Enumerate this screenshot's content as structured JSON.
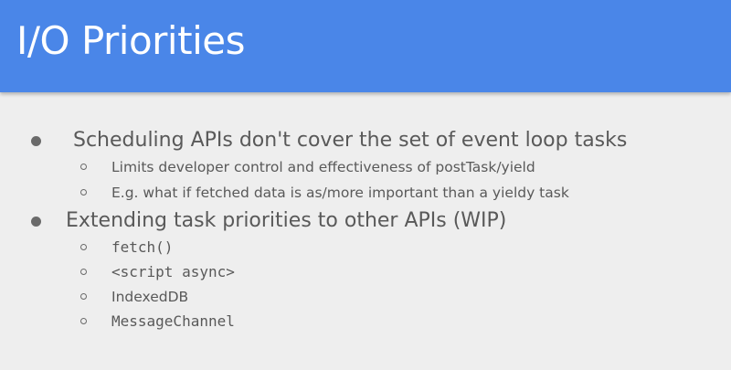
{
  "slide": {
    "title": "I/O Priorities",
    "colors": {
      "header_background": "#4a86e8",
      "title_text": "#ffffff",
      "body_background": "#eeeeee",
      "body_text": "#595959"
    },
    "bullets": [
      {
        "text": "Scheduling APIs don't cover the set of event loop tasks",
        "sub": [
          "Limits developer control and effectiveness of postTask/yield",
          "E.g. what if fetched data is as/more important than a yieldy task"
        ]
      },
      {
        "text": "Extending task priorities to other APIs (WIP)",
        "sub": [
          "fetch()",
          "<script async>",
          "IndexedDB",
          "MessageChannel"
        ]
      }
    ]
  }
}
